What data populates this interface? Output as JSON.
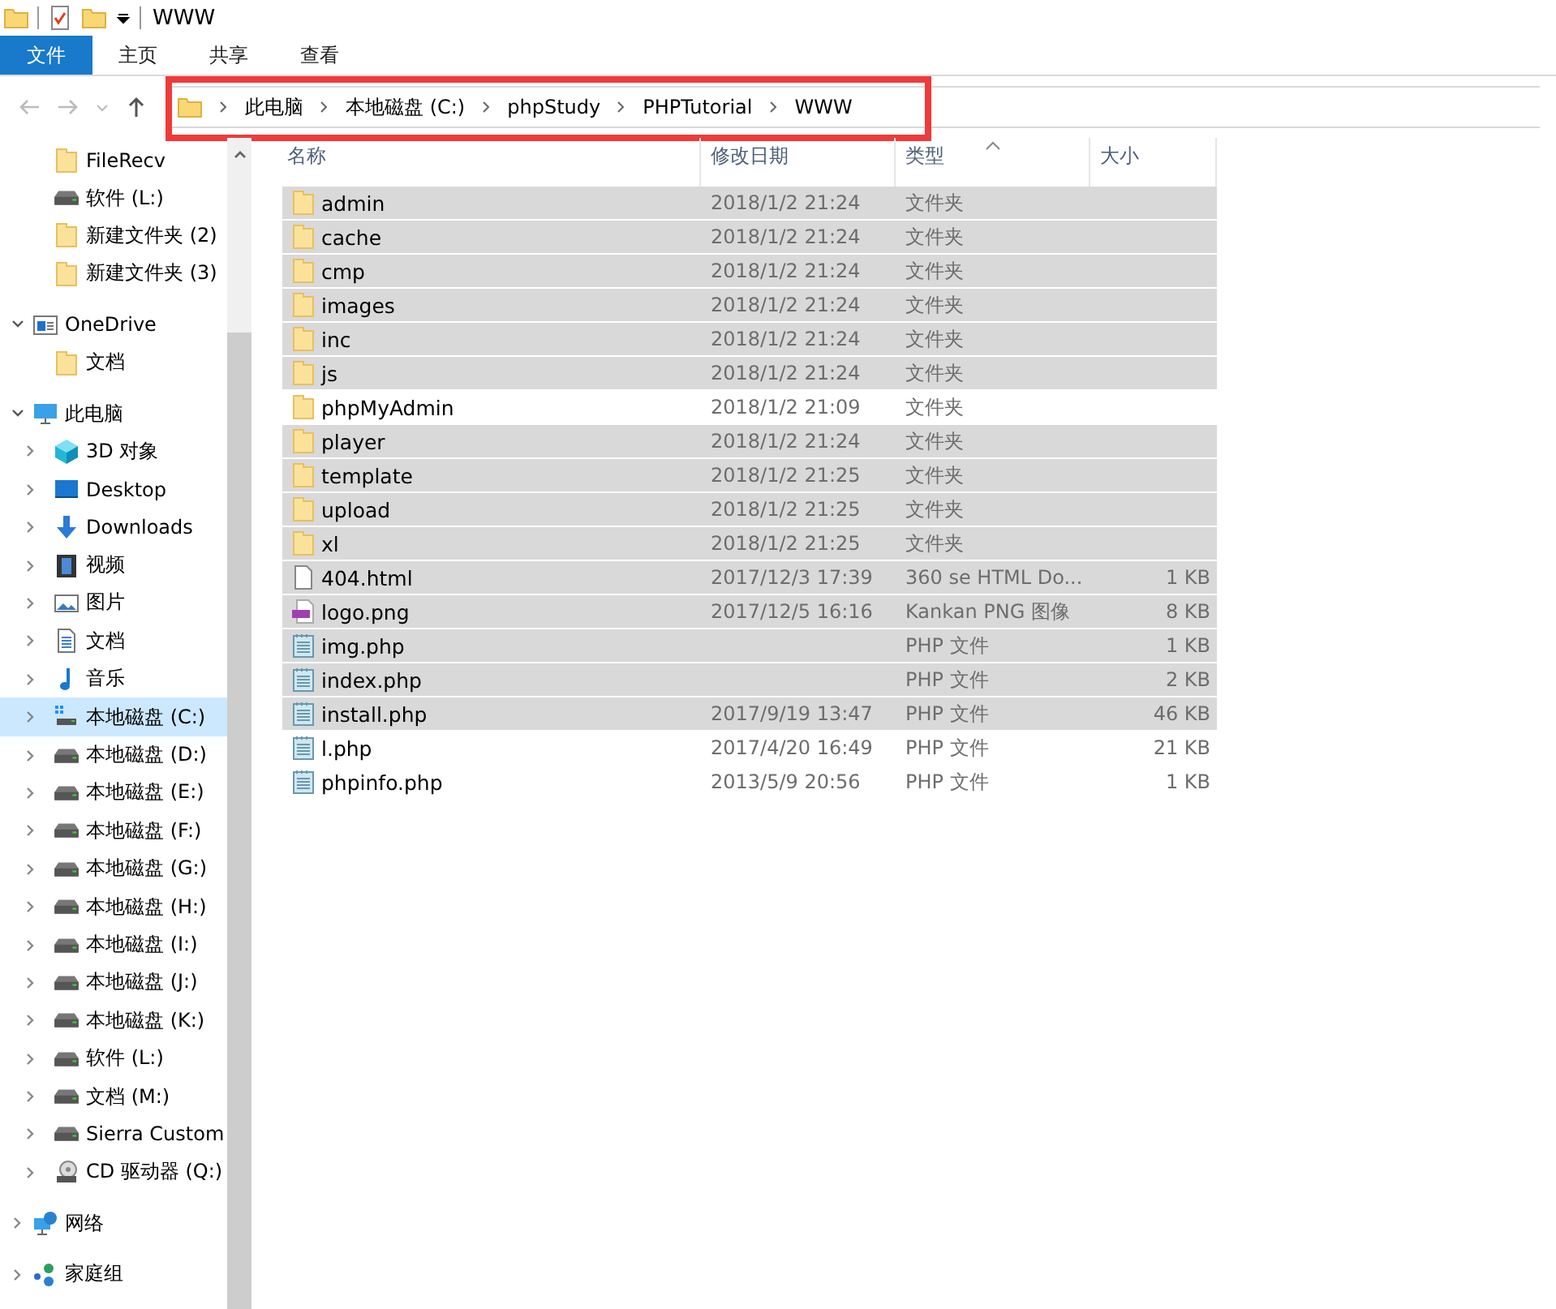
{
  "window": {
    "title": "WWW"
  },
  "ribbon": {
    "tabs": [
      {
        "label": "文件",
        "kind": "file",
        "selected": false
      },
      {
        "label": "主页",
        "kind": "tab",
        "selected": false
      },
      {
        "label": "共享",
        "kind": "tab",
        "selected": false
      },
      {
        "label": "查看",
        "kind": "tab",
        "selected": false
      }
    ]
  },
  "address_bar": {
    "highlighted": true,
    "path": [
      "此电脑",
      "本地磁盘 (C:)",
      "phpStudy",
      "PHPTutorial",
      "WWW"
    ]
  },
  "sidebar": {
    "items": [
      {
        "children": [
          {
            "label": "FileRecv",
            "kind": "folder",
            "selected": false
          },
          {
            "label": "软件 (L:)",
            "kind": "drive",
            "selected": false
          },
          {
            "label": "新建文件夹 (2)",
            "kind": "folder",
            "selected": false
          },
          {
            "label": "新建文件夹 (3)",
            "kind": "folder",
            "selected": false
          }
        ]
      },
      {
        "label": "OneDrive",
        "kind": "onedrive",
        "expanded": true,
        "selected": false,
        "children": [
          {
            "label": "文档",
            "kind": "folder",
            "selected": false
          }
        ]
      },
      {
        "label": "此电脑",
        "kind": "pc",
        "expanded": true,
        "selected": false,
        "children": [
          {
            "label": "3D 对象",
            "kind": "cube",
            "expanded": false,
            "selected": false
          },
          {
            "label": "Desktop",
            "kind": "desktop",
            "expanded": false,
            "selected": false
          },
          {
            "label": "Downloads",
            "kind": "download",
            "expanded": false,
            "selected": false
          },
          {
            "label": "视频",
            "kind": "video",
            "expanded": false,
            "selected": false
          },
          {
            "label": "图片",
            "kind": "picture",
            "expanded": false,
            "selected": false
          },
          {
            "label": "文档",
            "kind": "doc",
            "expanded": false,
            "selected": false
          },
          {
            "label": "音乐",
            "kind": "music",
            "expanded": false,
            "selected": false
          },
          {
            "label": "本地磁盘 (C:)",
            "kind": "sysdrive",
            "expanded": false,
            "selected": true
          },
          {
            "label": "本地磁盘 (D:)",
            "kind": "drive",
            "expanded": false,
            "selected": false
          },
          {
            "label": "本地磁盘 (E:)",
            "kind": "drive",
            "expanded": false,
            "selected": false
          },
          {
            "label": "本地磁盘 (F:)",
            "kind": "drive",
            "expanded": false,
            "selected": false
          },
          {
            "label": "本地磁盘 (G:)",
            "kind": "drive",
            "expanded": false,
            "selected": false
          },
          {
            "label": "本地磁盘 (H:)",
            "kind": "drive",
            "expanded": false,
            "selected": false
          },
          {
            "label": "本地磁盘 (I:)",
            "kind": "drive",
            "expanded": false,
            "selected": false
          },
          {
            "label": "本地磁盘 (J:)",
            "kind": "drive",
            "expanded": false,
            "selected": false
          },
          {
            "label": "本地磁盘 (K:)",
            "kind": "drive",
            "expanded": false,
            "selected": false
          },
          {
            "label": "软件 (L:)",
            "kind": "drive",
            "expanded": false,
            "selected": false
          },
          {
            "label": "文档 (M:)",
            "kind": "drive",
            "expanded": false,
            "selected": false
          },
          {
            "label": "Sierra Custom",
            "kind": "drive",
            "expanded": false,
            "selected": false
          },
          {
            "label": "CD 驱动器 (Q:)",
            "kind": "cd",
            "expanded": false,
            "selected": false
          }
        ]
      },
      {
        "label": "网络",
        "kind": "network",
        "expanded": false,
        "selected": false
      },
      {
        "label": "家庭组",
        "kind": "homegroup",
        "expanded": false,
        "selected": false
      }
    ]
  },
  "file_list": {
    "columns": [
      "名称",
      "修改日期",
      "类型",
      "大小"
    ],
    "rows": [
      {
        "name": "admin",
        "kind": "folder",
        "date": "2018/1/2 21:24",
        "type": "文件夹",
        "selected": true
      },
      {
        "name": "cache",
        "kind": "folder",
        "date": "2018/1/2 21:24",
        "type": "文件夹",
        "selected": true
      },
      {
        "name": "cmp",
        "kind": "folder",
        "date": "2018/1/2 21:24",
        "type": "文件夹",
        "selected": true
      },
      {
        "name": "images",
        "kind": "folder",
        "date": "2018/1/2 21:24",
        "type": "文件夹",
        "selected": true
      },
      {
        "name": "inc",
        "kind": "folder",
        "date": "2018/1/2 21:24",
        "type": "文件夹",
        "selected": true
      },
      {
        "name": "js",
        "kind": "folder",
        "date": "2018/1/2 21:24",
        "type": "文件夹",
        "selected": true
      },
      {
        "name": "phpMyAdmin",
        "kind": "folder",
        "date": "2018/1/2 21:09",
        "type": "文件夹",
        "selected": false
      },
      {
        "name": "player",
        "kind": "folder",
        "date": "2018/1/2 21:24",
        "type": "文件夹",
        "selected": true
      },
      {
        "name": "template",
        "kind": "folder",
        "date": "2018/1/2 21:25",
        "type": "文件夹",
        "selected": true
      },
      {
        "name": "upload",
        "kind": "folder",
        "date": "2018/1/2 21:25",
        "type": "文件夹",
        "selected": true
      },
      {
        "name": "xl",
        "kind": "folder",
        "date": "2018/1/2 21:25",
        "type": "文件夹",
        "selected": true
      },
      {
        "name": "404.html",
        "kind": "html",
        "date": "2017/12/3 17:39",
        "type": "360 se HTML Do...",
        "size": "1 KB",
        "selected": true
      },
      {
        "name": "logo.png",
        "kind": "png",
        "date": "2017/12/5 16:16",
        "type": "Kankan PNG 图像",
        "size": "8 KB",
        "selected": true
      },
      {
        "name": "img.php",
        "kind": "php",
        "type": "PHP 文件",
        "size": "1 KB",
        "selected": true
      },
      {
        "name": "index.php",
        "kind": "php",
        "type": "PHP 文件",
        "size": "2 KB",
        "selected": true
      },
      {
        "name": "install.php",
        "kind": "php",
        "date": "2017/9/19 13:47",
        "type": "PHP 文件",
        "size": "46 KB",
        "selected": true
      },
      {
        "name": "l.php",
        "kind": "php",
        "date": "2017/4/20 16:49",
        "type": "PHP 文件",
        "size": "21 KB",
        "selected": false
      },
      {
        "name": "phpinfo.php",
        "kind": "php",
        "date": "2013/5/9 20:56",
        "type": "PHP 文件",
        "size": "1 KB",
        "selected": false
      }
    ]
  }
}
